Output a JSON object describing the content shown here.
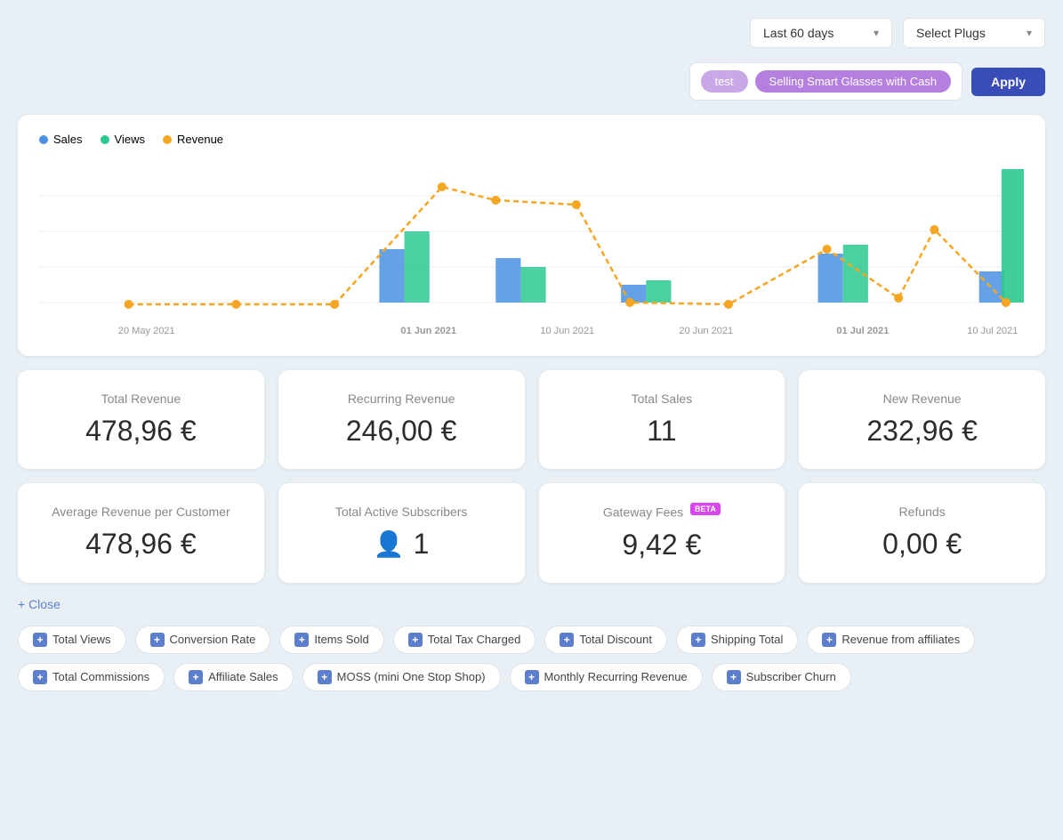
{
  "topbar": {
    "date_range_label": "Last 60 days",
    "select_plugs_label": "Select Plugs",
    "apply_label": "Apply"
  },
  "plugs": {
    "tags": [
      {
        "id": "test",
        "label": "test"
      },
      {
        "id": "smart-glasses",
        "label": "Selling Smart Glasses with Cash"
      }
    ]
  },
  "chart": {
    "legend": [
      {
        "id": "sales",
        "label": "Sales",
        "color": "#4a90e2"
      },
      {
        "id": "views",
        "label": "Views",
        "color": "#2bc98e"
      },
      {
        "id": "revenue",
        "label": "Revenue",
        "color": "#f5a623"
      }
    ],
    "x_labels": [
      "20 May 2021",
      "01 Jun 2021",
      "10 Jun 2021",
      "20 Jun 2021",
      "01 Jul 2021",
      "10 Jul 2021"
    ]
  },
  "metrics_row1": [
    {
      "id": "total-revenue",
      "label": "Total Revenue",
      "value": "478,96 €"
    },
    {
      "id": "recurring-revenue",
      "label": "Recurring Revenue",
      "value": "246,00 €"
    },
    {
      "id": "total-sales",
      "label": "Total Sales",
      "value": "11"
    },
    {
      "id": "new-revenue",
      "label": "New Revenue",
      "value": "232,96 €"
    }
  ],
  "metrics_row2": [
    {
      "id": "avg-revenue",
      "label": "Average Revenue per Customer",
      "value": "478,96 €"
    },
    {
      "id": "total-subscribers",
      "label": "Total Active Subscribers",
      "value": "1",
      "icon": "user"
    },
    {
      "id": "gateway-fees",
      "label": "Gateway Fees",
      "value": "9,42 €",
      "badge": "BETA"
    },
    {
      "id": "refunds",
      "label": "Refunds",
      "value": "0,00 €"
    }
  ],
  "close_label": "+ Close",
  "add_metrics": [
    {
      "id": "total-views",
      "label": "Total Views"
    },
    {
      "id": "conversion-rate",
      "label": "Conversion Rate"
    },
    {
      "id": "items-sold",
      "label": "Items Sold"
    },
    {
      "id": "total-tax-charged",
      "label": "Total Tax Charged"
    },
    {
      "id": "total-discount",
      "label": "Total Discount"
    },
    {
      "id": "shipping-total",
      "label": "Shipping Total"
    },
    {
      "id": "revenue-from-affiliates",
      "label": "Revenue from affiliates"
    },
    {
      "id": "total-commissions",
      "label": "Total Commissions"
    },
    {
      "id": "affiliate-sales",
      "label": "Affiliate Sales"
    },
    {
      "id": "moss",
      "label": "MOSS (mini One Stop Shop)"
    },
    {
      "id": "monthly-recurring-revenue",
      "label": "Monthly Recurring Revenue"
    },
    {
      "id": "subscriber-churn",
      "label": "Subscriber Churn"
    }
  ]
}
